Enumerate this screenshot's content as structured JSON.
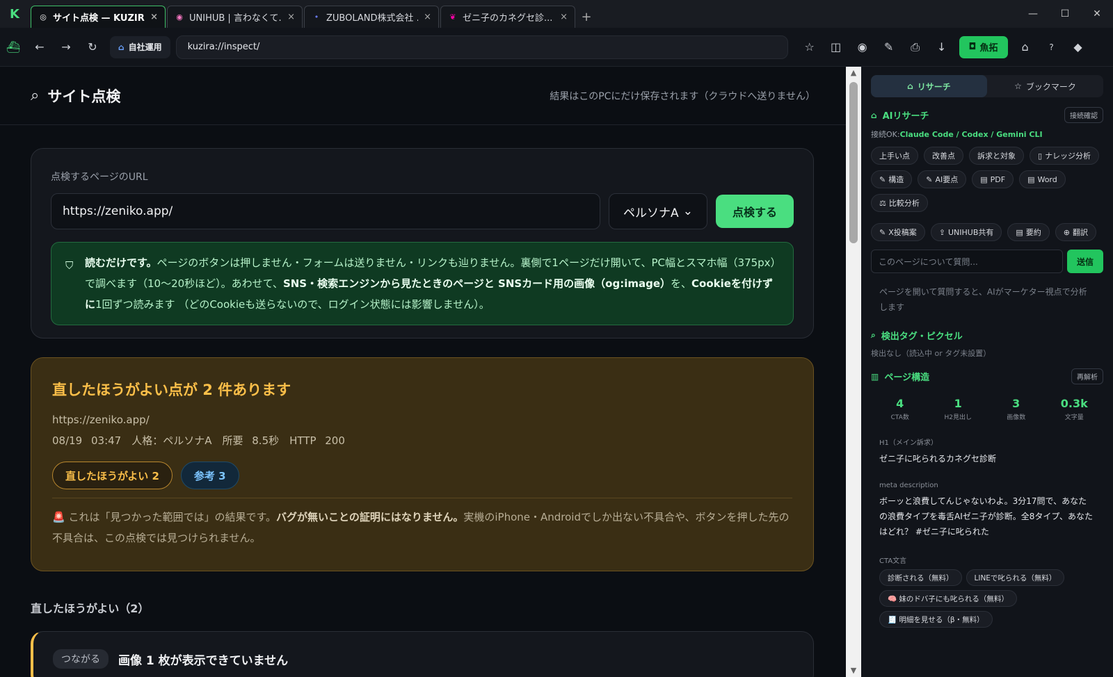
{
  "tabs": [
    {
      "title": "サイト点検 — KUZIRA",
      "icon": "globe-icon",
      "active": true
    },
    {
      "title": "UNIHUB | 言わなくて...",
      "icon": "unihub-icon"
    },
    {
      "title": "ZUBOLAND株式会社 ...",
      "icon": "dot-icon"
    },
    {
      "title": "ゼニ子のカネグセ診...",
      "icon": "zeniko-icon"
    }
  ],
  "toolbar": {
    "home_label": "自社運用",
    "url": "kuzira://inspect/",
    "gyotaku_label": "魚拓",
    "help": "?"
  },
  "page": {
    "title": "サイト点検",
    "storage_note": "結果はこのPCにだけ保存されます（クラウドへ送りません）",
    "form": {
      "url_label": "点検するページのURL",
      "url_value": "https://zeniko.app/",
      "persona": "ペルソナA",
      "submit": "点検する",
      "notice_1": "読むだけです。",
      "notice_2": "ページのボタンは押しません・フォームは送りません・リンクも辿りません。裏側で1ページだけ開いて、PC幅とスマホ幅（375px）で調べます（10〜20秒ほど）。あわせて、",
      "notice_3": "SNS・検索エンジンから見たときのページと SNSカード用の画像（og:image）",
      "notice_4": "を、",
      "notice_5": "Cookieを付けずに",
      "notice_6": "1回ずつ読みます （どのCookieも送らないので、ログイン状態には影響しません）。"
    },
    "result": {
      "heading": "直したほうがよい点が 2 件あります",
      "url": "https://zeniko.app/",
      "meta": "08/19 03:47　人格：ペルソナA　所要 8.5秒　HTTP 200",
      "badge_warn": "直したほうがよい 2",
      "badge_info": "参考 3",
      "caveat_1": "これは「見つかった範囲では」の結果です。",
      "caveat_2": "バグが無いことの証明にはなりません。",
      "caveat_3": "実機のiPhone・Androidでしか出ない不具合や、ボタンを押した先の不具合は、この点検では見つけられません。"
    },
    "section_title": "直したほうがよい（2）",
    "issue": {
      "tag": "つながる",
      "title": "画像 1 枚が表示できていません"
    }
  },
  "sidebar": {
    "tab_research": "リサーチ",
    "tab_bookmark": "ブックマーク",
    "ai_title": "AIリサーチ",
    "ai_check": "接続確認",
    "conn_prefix": "接続OK:",
    "conn_tools": "Claude Code / Codex / Gemini CLI",
    "chips_row1": [
      "上手い点",
      "改善点",
      "訴求と対象",
      "ナレッジ分析"
    ],
    "chips_row2": [
      "構造",
      "AI要点",
      "PDF",
      "Word"
    ],
    "chips_row3": [
      "比較分析"
    ],
    "chips_row4": [
      "X投稿案",
      "UNIHUB共有",
      "要約",
      "翻訳"
    ],
    "ask_placeholder": "このページについて質問...",
    "send": "送信",
    "hint": "ページを開いて質問すると、AIがマーケター視点で分析します",
    "tags_title": "検出タグ・ピクセル",
    "tags_none": "検出なし（読込中 or タグ未設置）",
    "structure_title": "ページ構造",
    "reanalyze": "再解析",
    "stats": [
      {
        "v": "4",
        "l": "CTA数"
      },
      {
        "v": "1",
        "l": "H2見出し"
      },
      {
        "v": "3",
        "l": "画像数"
      },
      {
        "v": "0.3k",
        "l": "文字量"
      }
    ],
    "h1_label": "H1（メイン訴求）",
    "h1_value": "ゼニ子に叱られるカネグセ診断",
    "meta_label": "meta description",
    "meta_value": "ボーッと浪費してんじゃないわよ。3分17問で、あなたの浪費タイプを毒舌AIゼニ子が診断。全8タイプ、あなたはどれ？ #ゼニ子に叱られた",
    "cta_label": "CTA文言",
    "cta": [
      "診断される（無料）",
      "LINEで叱られる（無料）",
      "🧠 妹のドバ子にも叱られる（無料）",
      "🧾 明細を見せる（β・無料）"
    ]
  },
  "colors": {
    "accent": "#4ade80",
    "warn": "#fbbf49",
    "info": "#7cc4ff"
  }
}
